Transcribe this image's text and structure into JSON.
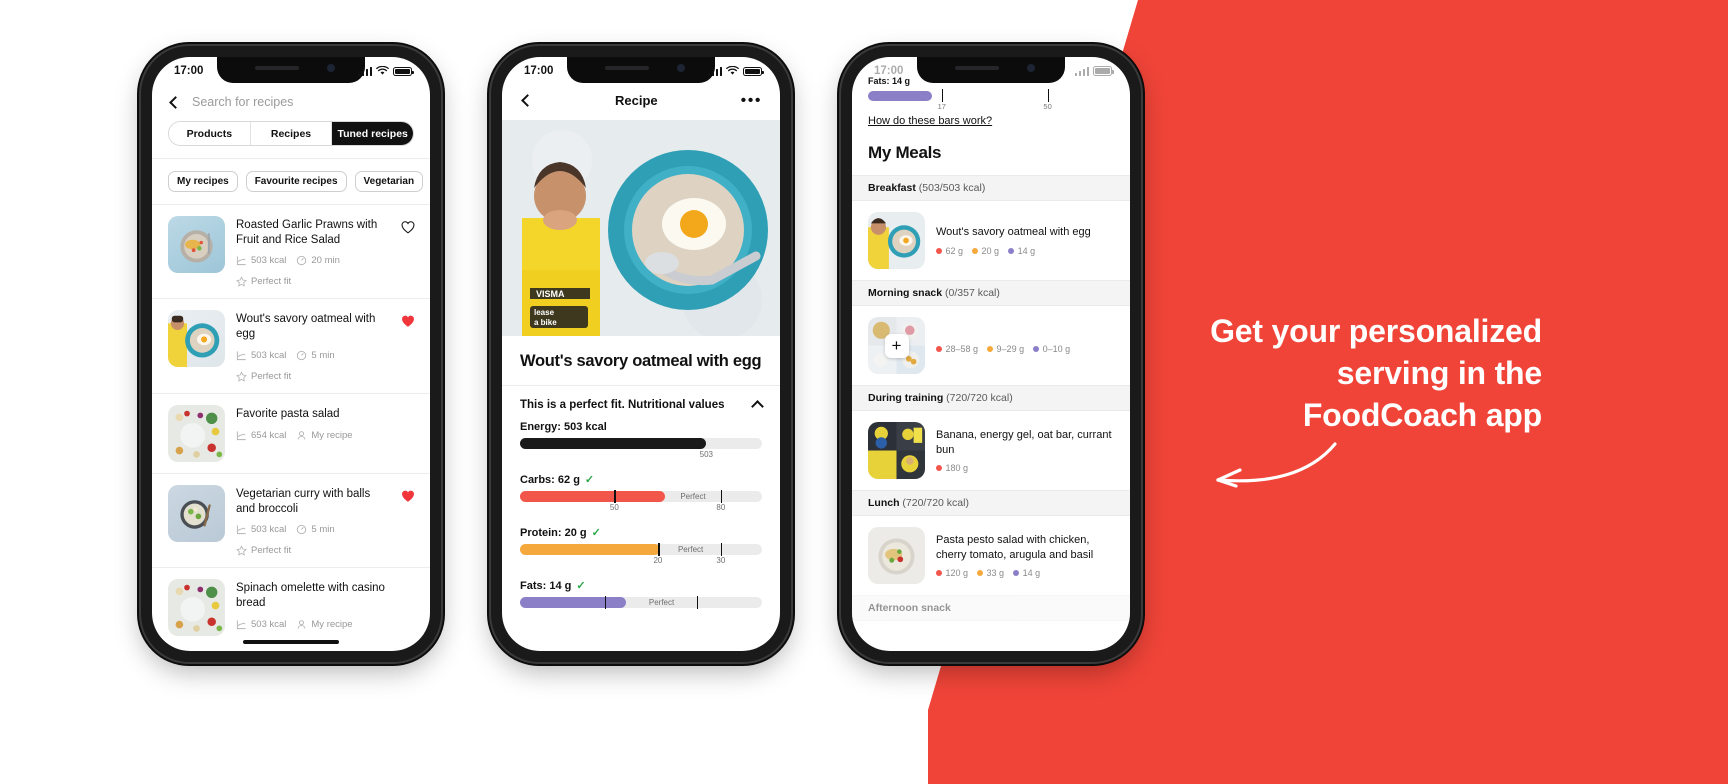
{
  "promo": {
    "line1": "Get your personalized",
    "line2": "serving in the",
    "line3": "FoodCoach app",
    "background_color": "#F04438",
    "text_color": "#FFFFFF",
    "arrow_icon": "curved-arrow-left-icon"
  },
  "colors": {
    "accent_red": "#F04438",
    "carbs": "#F2564B",
    "protein": "#F5A93C",
    "fats": "#8B80C8",
    "energy": "#1A1A1A",
    "check_green": "#2AA84A",
    "heart_filled": "#F0353B"
  },
  "phone1": {
    "status": {
      "time": "17:00",
      "signal_icon": "signal-bars-icon",
      "wifi_icon": "wifi-icon",
      "battery_icon": "battery-full-icon"
    },
    "search": {
      "back_icon": "chevron-left-icon",
      "placeholder": "Search for recipes",
      "value": ""
    },
    "segmented": {
      "options": [
        "Products",
        "Recipes",
        "Tuned recipes"
      ],
      "selected": "Tuned recipes"
    },
    "chips": [
      "My recipes",
      "Favourite recipes",
      "Vegetarian"
    ],
    "recipes": [
      {
        "title": "Roasted Garlic Prawns with Fruit and Rice Salad",
        "kcal": "503 kcal",
        "time": "20 min",
        "fit": "Perfect fit",
        "favourite": false,
        "meta_type": "fit"
      },
      {
        "title": "Wout's savory oatmeal with egg",
        "kcal": "503 kcal",
        "time": "5 min",
        "fit": "Perfect fit",
        "favourite": true,
        "meta_type": "fit"
      },
      {
        "title": "Favorite pasta salad",
        "kcal": "654 kcal",
        "time": "",
        "fit": "My recipe",
        "favourite": false,
        "meta_type": "mine"
      },
      {
        "title": "Vegetarian curry with balls and broccoli",
        "kcal": "503 kcal",
        "time": "5 min",
        "fit": "Perfect fit",
        "favourite": true,
        "meta_type": "fit"
      },
      {
        "title": "Spinach omelette with casino bread",
        "kcal": "503 kcal",
        "time": "",
        "fit": "My recipe",
        "favourite": false,
        "meta_type": "mine"
      }
    ]
  },
  "phone2": {
    "status": {
      "time": "17:00"
    },
    "nav": {
      "back_icon": "chevron-left-icon",
      "title": "Recipe",
      "more_icon": "more-horizontal-icon"
    },
    "recipe_title": "Wout's savory oatmeal with egg",
    "nutrition_section": {
      "heading": "This is a perfect fit. Nutritional values",
      "collapse_icon": "chevron-up-icon"
    },
    "bars": [
      {
        "label": "Energy: 503 kcal",
        "checked": false,
        "color": "#1A1A1A",
        "fill_pct": 77,
        "ticks": [],
        "perfect_label": "",
        "numbers": [
          {
            "value": "503",
            "pos_pct": 77
          }
        ]
      },
      {
        "label": "Carbs: 62 g",
        "checked": true,
        "color": "#F2564B",
        "fill_pct": 60,
        "ticks": [
          {
            "pos_pct": 39
          },
          {
            "pos_pct": 83
          }
        ],
        "perfect_label": "Perfect",
        "perfect_start_pct": 60,
        "perfect_end_pct": 83,
        "numbers": [
          {
            "value": "50",
            "pos_pct": 39
          },
          {
            "value": "80",
            "pos_pct": 83
          }
        ]
      },
      {
        "label": "Protein: 20 g",
        "checked": true,
        "color": "#F5A93C",
        "fill_pct": 58,
        "ticks": [
          {
            "pos_pct": 57
          },
          {
            "pos_pct": 83
          }
        ],
        "perfect_label": "Perfect",
        "perfect_start_pct": 58,
        "perfect_end_pct": 83,
        "numbers": [
          {
            "value": "20",
            "pos_pct": 57
          },
          {
            "value": "30",
            "pos_pct": 83
          }
        ]
      },
      {
        "label": "Fats: 14 g",
        "checked": true,
        "color": "#8B80C8",
        "fill_pct": 44,
        "ticks": [
          {
            "pos_pct": 35
          },
          {
            "pos_pct": 73
          }
        ],
        "perfect_label": "Perfect",
        "perfect_start_pct": 44,
        "perfect_end_pct": 73,
        "numbers": []
      }
    ]
  },
  "phone3": {
    "status": {
      "time": "17:00"
    },
    "top_bar": {
      "label": "Fats: 14 g",
      "color": "#8B80C8",
      "ticks": [
        {
          "pos_pct": 30,
          "value": "17"
        },
        {
          "pos_pct": 73,
          "value": "50"
        }
      ]
    },
    "how_link": "How do these bars work?",
    "heading": "My Meals",
    "meals": [
      {
        "name": "Breakfast",
        "kcal": "(503/503 kcal)",
        "faded": false,
        "items": [
          {
            "title": "Wout's savory oatmeal with egg",
            "thumb": "oatmeal-egg-thumb",
            "add": false,
            "macros": [
              {
                "value": "62 g",
                "color": "#F2564B"
              },
              {
                "value": "20 g",
                "color": "#F5A93C"
              },
              {
                "value": "14 g",
                "color": "#8B80C8"
              }
            ]
          }
        ]
      },
      {
        "name": "Morning snack",
        "kcal": "(0/357 kcal)",
        "faded": false,
        "items": [
          {
            "title": "",
            "thumb": "snack-grid-thumb",
            "add": true,
            "macros": [
              {
                "value": "28–58 g",
                "color": "#F2564B"
              },
              {
                "value": "9–29 g",
                "color": "#F5A93C"
              },
              {
                "value": "0–10 g",
                "color": "#8B80C8"
              }
            ]
          }
        ]
      },
      {
        "name": "During training",
        "kcal": "(720/720 kcal)",
        "faded": false,
        "items": [
          {
            "title": "Banana, energy gel, oat bar, currant bun",
            "thumb": "training-grid-thumb",
            "add": false,
            "macros": [
              {
                "value": "180 g",
                "color": "#F2564B"
              }
            ]
          }
        ]
      },
      {
        "name": "Lunch",
        "kcal": "(720/720 kcal)",
        "faded": false,
        "items": [
          {
            "title": "Pasta pesto salad with chicken, cherry tomato, arugula and basil",
            "thumb": "pasta-salad-thumb",
            "add": false,
            "macros": [
              {
                "value": "120 g",
                "color": "#F2564B"
              },
              {
                "value": "33 g",
                "color": "#F5A93C"
              },
              {
                "value": "14 g",
                "color": "#8B80C8"
              }
            ]
          }
        ]
      },
      {
        "name": "Afternoon snack",
        "kcal": "",
        "faded": true,
        "items": []
      }
    ]
  }
}
